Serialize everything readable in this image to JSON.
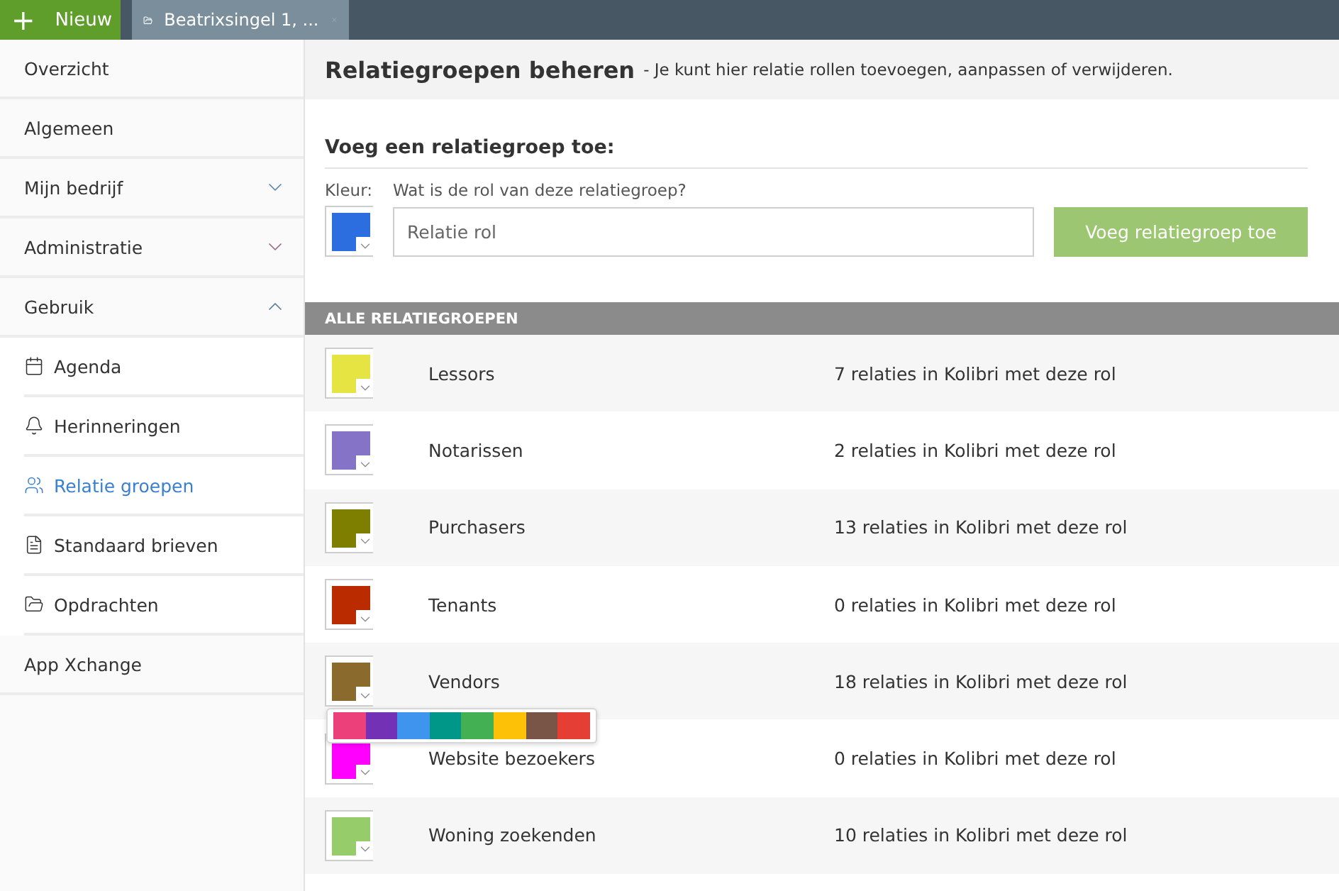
{
  "topbar": {
    "new_button": {
      "icon": "+",
      "label": "Nieuw"
    },
    "tabs": [
      {
        "label": "Beatrixsingel 1, ...",
        "selected": true
      }
    ]
  },
  "sidebar": {
    "items": [
      {
        "label": "Overzicht"
      },
      {
        "label": "Algemeen"
      },
      {
        "label": "Mijn bedrijf",
        "expanded": false
      },
      {
        "label": "Administratie",
        "expanded": false
      },
      {
        "label": "Gebruik",
        "expanded": true,
        "children": [
          {
            "label": "Agenda",
            "selected": false
          },
          {
            "label": "Herinneringen",
            "selected": false
          },
          {
            "label": "Relatie groepen",
            "selected": true
          },
          {
            "label": "Standaard brieven",
            "selected": false
          },
          {
            "label": "Opdrachten",
            "selected": false
          }
        ]
      },
      {
        "label": "App Xchange"
      }
    ]
  },
  "header": {
    "title": "Relatiegroepen beheren",
    "subtitle": "- Je kunt hier relatie rollen toevoegen, aanpassen of verwijderen."
  },
  "add_form": {
    "heading": "Voeg een relatiegroep toe:",
    "color_label": "Kleur:",
    "color": "#2c6ee0",
    "role_label": "Wat is de rol van deze relatiegroep?",
    "role_placeholder": "Relatie rol",
    "submit": "Voeg relatiegroep toe",
    "submit_disabled": true
  },
  "list": {
    "header": "ALLE RELATIEGROEPEN",
    "rows": [
      {
        "name": "Lessors",
        "count": "7 relaties in Kolibri met deze rol",
        "color": "#e6e442",
        "picker_open": false
      },
      {
        "name": "Notarissen",
        "count": "2 relaties in Kolibri met deze rol",
        "color": "#8473c7",
        "picker_open": false
      },
      {
        "name": "Purchasers",
        "count": "13 relaties in Kolibri met deze rol",
        "color": "#7e7f00",
        "picker_open": false
      },
      {
        "name": "Tenants",
        "count": "0 relaties in Kolibri met deze rol",
        "color": "#bb2b00",
        "picker_open": false
      },
      {
        "name": "Vendors",
        "count": "18 relaties in Kolibri met deze rol",
        "color": "#8b6a2e",
        "picker_open": true
      },
      {
        "name": "Website bezoekers",
        "count": "0 relaties in Kolibri met deze rol",
        "color": "#ff00ff",
        "picker_open": false
      },
      {
        "name": "Woning zoekenden",
        "count": "10 relaties in Kolibri met deze rol",
        "color": "#96cc6a",
        "picker_open": false
      }
    ]
  },
  "palette": [
    {
      "color": "#ec407a"
    },
    {
      "color": "#7331b5"
    },
    {
      "color": "#3f95ee"
    },
    {
      "color": "#009688"
    },
    {
      "color": "#43b153"
    },
    {
      "color": "#fdc107"
    },
    {
      "color": "#795548"
    },
    {
      "color": "#e53f35"
    }
  ]
}
